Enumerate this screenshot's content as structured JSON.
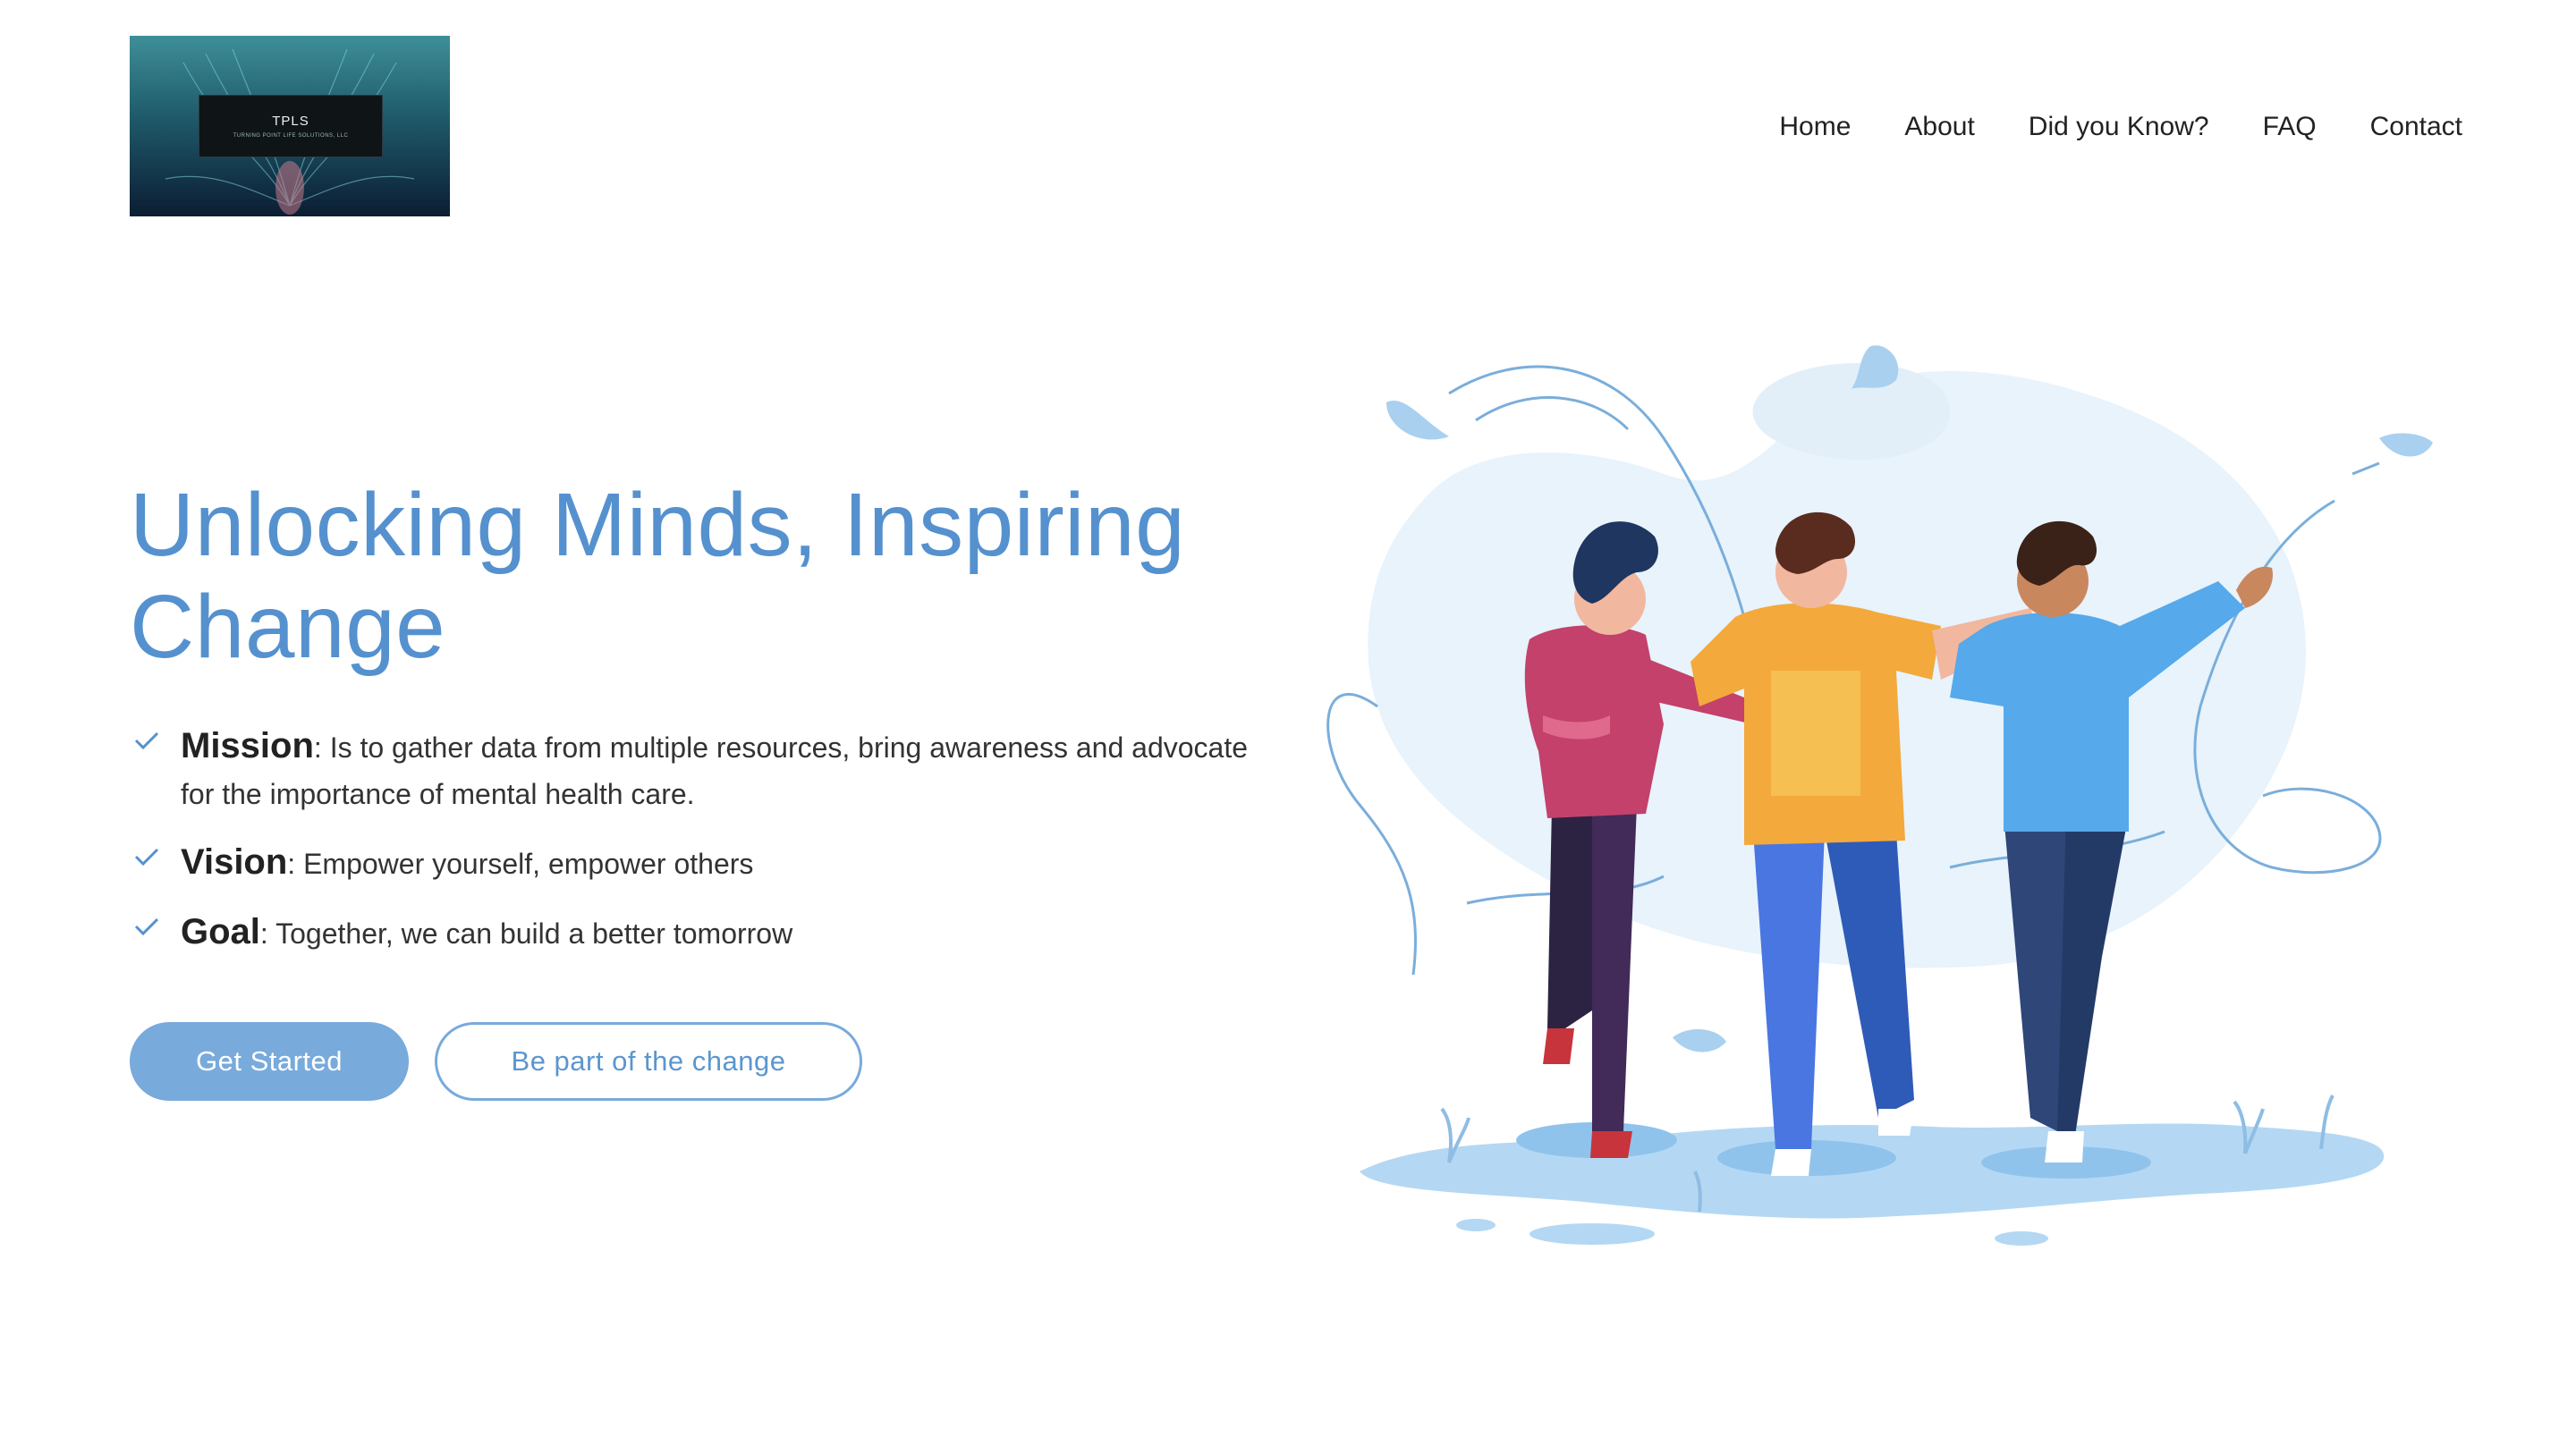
{
  "logo": {
    "title": "TPLS",
    "subtitle": "TURNING POINT LIFE SOLUTIONS, LLC"
  },
  "nav": {
    "items": [
      "Home",
      "About",
      "Did you Know?",
      "FAQ",
      "Contact"
    ]
  },
  "hero": {
    "title_line1": "Unlocking Minds, Inspiring",
    "title_line2": "Change",
    "features": [
      {
        "label": "Mission",
        "text": ": Is to gather data from multiple resources, bring awareness and advocate for the importance of mental health care."
      },
      {
        "label": "Vision",
        "text": ": Empower yourself, empower others"
      },
      {
        "label": "Goal",
        "text": ": Together, we can build a better tomorrow"
      }
    ],
    "primary_button": "Get Started",
    "secondary_button": "Be part of the change"
  },
  "colors": {
    "accent": "#5591ce",
    "button": "#78aadc",
    "logo_bg": "#1f5a6a"
  },
  "icons": [
    "check-icon",
    "people-illustration"
  ]
}
